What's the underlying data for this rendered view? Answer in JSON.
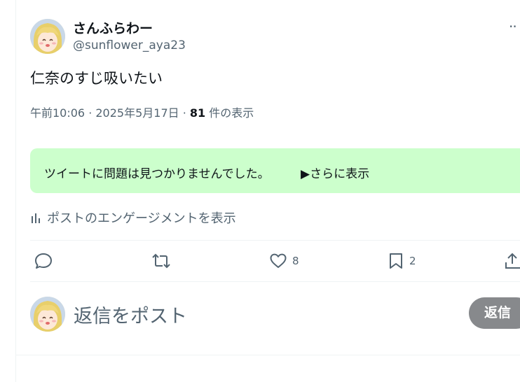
{
  "post": {
    "display_name": "さんふらわー",
    "handle": "@sunflower_aya23",
    "more_label": "··",
    "text": "仁奈のすじ吸いたい",
    "timestamp": "午前10:06 · 2025年5月17日 · ",
    "view_count": "81",
    "view_suffix": " 件の表示"
  },
  "notice": {
    "text": "ツイートに問題は見つかりませんでした。",
    "more_label": "▶さらに表示",
    "bg_color": "#ccffcc"
  },
  "engagement_label": "ポストのエンゲージメントを表示",
  "actions": [
    {
      "name": "reply",
      "icon": "reply-icon",
      "count": ""
    },
    {
      "name": "repost",
      "icon": "repost-icon",
      "count": ""
    },
    {
      "name": "like",
      "icon": "heart-icon",
      "count": "8"
    },
    {
      "name": "bookmark",
      "icon": "bookmark-icon",
      "count": "2"
    },
    {
      "name": "share",
      "icon": "share-icon",
      "count": ""
    }
  ],
  "reply_box": {
    "placeholder": "返信をポスト",
    "button_label": "返信",
    "button_color": "#87898c"
  },
  "colors": {
    "text": "#0f1419",
    "muted": "#536471",
    "border": "#eff3f4"
  }
}
